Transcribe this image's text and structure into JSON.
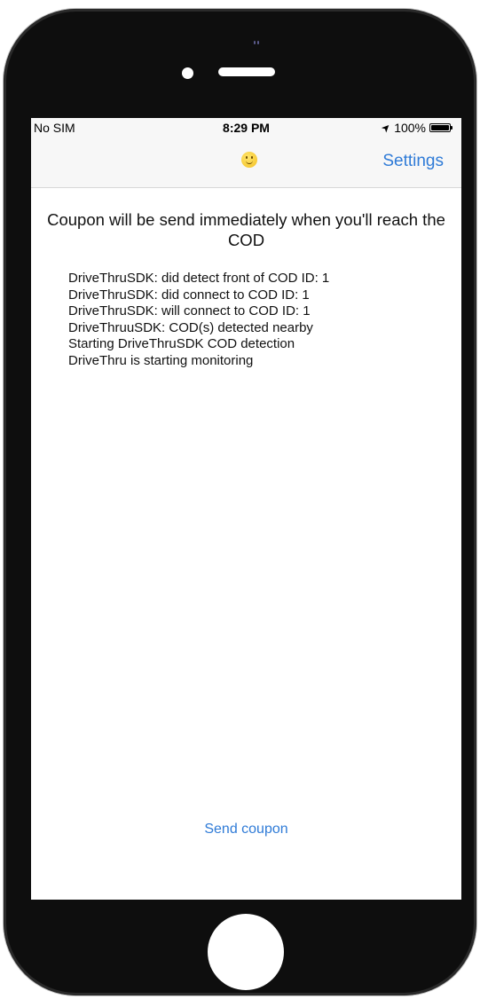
{
  "status_bar": {
    "carrier": "No SIM",
    "time": "8:29 PM",
    "location_glyph": "➤",
    "battery_percent": "100%"
  },
  "nav_bar": {
    "title_icon": "slightly-smiling-face-emoji",
    "settings_label": "Settings"
  },
  "main": {
    "headline": "Coupon will be send immediately when you'll reach the COD",
    "log_lines": [
      "DriveThruSDK: did detect front of COD ID: 1",
      "DriveThruSDK: did connect to COD ID: 1",
      "DriveThruSDK: will connect to COD ID: 1",
      "DriveThruuSDK: COD(s) detected nearby",
      "Starting DriveThruSDK COD detection",
      "DriveThru is starting monitoring"
    ],
    "send_coupon_label": "Send coupon"
  },
  "colors": {
    "accent": "#2f7bd7",
    "bezel": "#0e0e0e",
    "bar_background": "#f7f7f7"
  }
}
